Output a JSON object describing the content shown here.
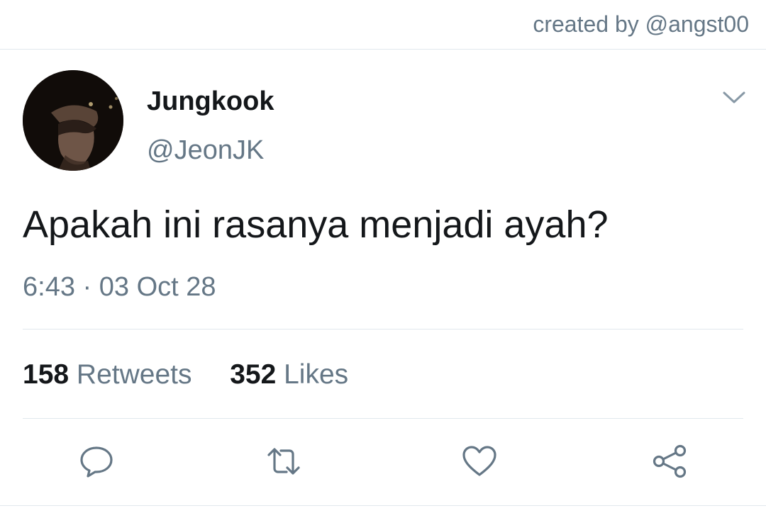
{
  "credit": "created by @angst00",
  "user": {
    "display_name": "Jungkook",
    "handle": "@JeonJK"
  },
  "tweet": {
    "text": "Apakah ini rasanya menjadi ayah?",
    "time": "6:43",
    "separator": "·",
    "date": "03 Oct 28"
  },
  "stats": {
    "retweets_count": "158",
    "retweets_label": "Retweets",
    "likes_count": "352",
    "likes_label": "Likes"
  },
  "icons": {
    "menu": "chevron-down-icon",
    "reply": "reply-icon",
    "retweet": "retweet-icon",
    "like": "heart-icon",
    "share": "share-icon"
  },
  "colors": {
    "primary_text": "#14171a",
    "secondary_text": "#657786",
    "divider": "#e1e8ed",
    "icon": "#657786"
  }
}
